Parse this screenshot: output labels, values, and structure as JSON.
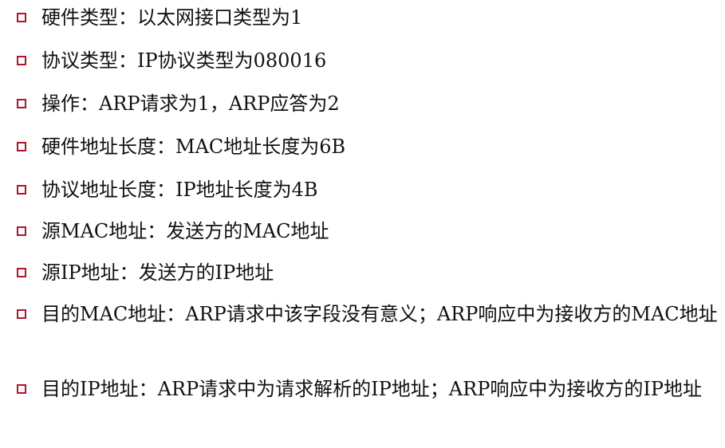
{
  "items": [
    {
      "text": "硬件类型：以太网接口类型为1"
    },
    {
      "text": "协议类型：IP协议类型为080016"
    },
    {
      "text": "操作：ARP请求为1，ARP应答为2"
    },
    {
      "text": "硬件地址长度：MAC地址长度为6B"
    },
    {
      "text": "协议地址长度：IP地址长度为4B"
    },
    {
      "text": "源MAC地址：发送方的MAC地址"
    },
    {
      "text": "源IP地址：发送方的IP地址"
    },
    {
      "text": "目的MAC地址：ARP请求中该字段没有意义；ARP响应中为接收方的MAC地址"
    },
    {
      "text": "目的IP地址：ARP请求中为请求解析的IP地址；ARP响应中为接收方的IP地址"
    }
  ],
  "colors": {
    "bullet": "#b3122b",
    "text": "#111111"
  }
}
